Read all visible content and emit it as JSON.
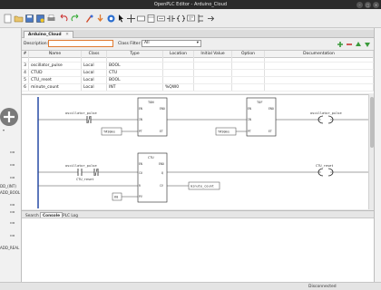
{
  "window": {
    "title": "OpenPLC Editor - Arduino_Cloud"
  },
  "toolbar": {
    "icons": [
      "new-file-icon",
      "open-folder-icon",
      "save-icon",
      "save-as-icon",
      "print-icon",
      "undo-icon",
      "redo-icon",
      "cut-icon",
      "copy-icon",
      "paste-icon",
      "find-icon",
      "fullscreen-icon",
      "compile-icon",
      "download-icon",
      "debug-icon",
      "select-icon",
      "move-icon",
      "add-variable-icon",
      "add-block-icon",
      "add-connection-icon",
      "add-contact-icon",
      "add-coil-icon",
      "add-comment-icon",
      "add-powerrail-icon",
      "add-jump-icon"
    ]
  },
  "tab": {
    "label": "Arduino_Cloud"
  },
  "filters": {
    "description_label": "Description:",
    "description_value": "",
    "class_filter_label": "Class Filter:",
    "class_filter_value": "All"
  },
  "variables": {
    "columns": [
      "#",
      "Name",
      "Class",
      "Type",
      "Location",
      "Initial Value",
      "Option",
      "Documentation"
    ],
    "rows": [
      {
        "num": "",
        "name": "",
        "class": "",
        "type": "",
        "location": "",
        "initial": "",
        "option": "",
        "doc": ""
      },
      {
        "num": "3",
        "name": "oscillator_pulse",
        "class": "Local",
        "type": "BOOL",
        "location": "",
        "initial": "",
        "option": "",
        "doc": ""
      },
      {
        "num": "4",
        "name": "CTUD",
        "class": "Local",
        "type": "CTU",
        "location": "",
        "initial": "",
        "option": "",
        "doc": ""
      },
      {
        "num": "5",
        "name": "CTU_reset",
        "class": "Local",
        "type": "BOOL",
        "location": "",
        "initial": "",
        "option": "",
        "doc": ""
      },
      {
        "num": "6",
        "name": "minute_count",
        "class": "Local",
        "type": "INT",
        "location": "%QW0",
        "initial": "",
        "option": "",
        "doc": ""
      }
    ]
  },
  "ladder": {
    "block1": {
      "type": "TON",
      "in": "IN",
      "pt": "PT",
      "q": "ENO",
      "et": "ET",
      "en": "EN"
    },
    "block2": {
      "type": "TOF",
      "in": "IN",
      "pt": "PT",
      "q": "ENO",
      "et": "ET",
      "en": "EN"
    },
    "block3": {
      "type": "CTU",
      "cu": "CU",
      "r": "R",
      "pv": "PV",
      "q": "Q",
      "cv": "CV",
      "en": "EN",
      "eno": "ENO"
    },
    "pt1": "T#30ms",
    "pt2": "T#30ms",
    "pv": "60",
    "contact1": "oscillator_pulse",
    "coil1": "oscillator_pulse",
    "contact2": "oscillator_pulse",
    "contact3": "CTU_reset",
    "out_var": "minute_count",
    "coil2": "CTU_reset"
  },
  "left_panel": {
    "items": [
      "DD_(INT)",
      "ADD_BOOL",
      "ADD_REAL"
    ]
  },
  "bottom_tabs": [
    "Search",
    "Console",
    "PLC Log"
  ],
  "status": {
    "text": "Disconnected"
  },
  "colors": {
    "accent": "#e07a30",
    "title_bg": "#2b2b2b",
    "rail": "#3355aa"
  }
}
